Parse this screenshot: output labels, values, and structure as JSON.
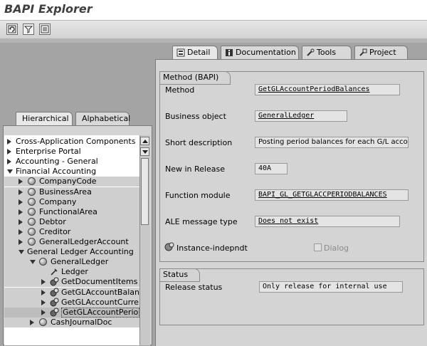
{
  "window": {
    "title": "BAPI Explorer"
  },
  "toolbar": {
    "icons": [
      "refresh-icon",
      "filter-icon",
      "list-icon"
    ]
  },
  "left_tabs": [
    "Hierarchical",
    "Alphabetical"
  ],
  "right_tabs": [
    "Detail",
    "Documentation",
    "Tools",
    "Project"
  ],
  "tree": {
    "items": [
      {
        "label": "Cross-Application Components",
        "level": 0,
        "expanded": false,
        "icon": "triangle"
      },
      {
        "label": "Enterprise Portal",
        "level": 0,
        "expanded": false,
        "icon": "triangle"
      },
      {
        "label": "Accounting - General",
        "level": 0,
        "expanded": false,
        "icon": "triangle"
      },
      {
        "label": "Financial Accounting",
        "level": 0,
        "expanded": true,
        "icon": "triangle"
      },
      {
        "label": "CompanyCode",
        "level": 1,
        "expanded": false,
        "icon": "object"
      },
      {
        "label": "BusinessArea",
        "level": 1,
        "expanded": false,
        "icon": "object"
      },
      {
        "label": "Company",
        "level": 1,
        "expanded": false,
        "icon": "object"
      },
      {
        "label": "FunctionalArea",
        "level": 1,
        "expanded": false,
        "icon": "object"
      },
      {
        "label": "Debtor",
        "level": 1,
        "expanded": false,
        "icon": "object"
      },
      {
        "label": "Creditor",
        "level": 1,
        "expanded": false,
        "icon": "object"
      },
      {
        "label": "GeneralLedgerAccount",
        "level": 1,
        "expanded": false,
        "icon": "object"
      },
      {
        "label": "General Ledger Accounting",
        "level": 1,
        "expanded": true,
        "icon": "triangle"
      },
      {
        "label": "GeneralLedger",
        "level": 2,
        "expanded": true,
        "icon": "object"
      },
      {
        "label": "Ledger",
        "level": 3,
        "expanded": false,
        "icon": "key"
      },
      {
        "label": "GetDocumentItems",
        "level": 3,
        "expanded": false,
        "icon": "method"
      },
      {
        "label": "GetGLAccountBalan",
        "level": 3,
        "expanded": false,
        "icon": "method"
      },
      {
        "label": "GetGLAccountCurre",
        "level": 3,
        "expanded": false,
        "icon": "method"
      },
      {
        "label": "GetGLAccountPerio",
        "level": 3,
        "expanded": false,
        "icon": "method",
        "selected": true
      },
      {
        "label": "CashJournalDoc",
        "level": 2,
        "expanded": false,
        "icon": "object"
      }
    ]
  },
  "method_group": {
    "title": "Method (BAPI)",
    "fields": [
      {
        "label": "Method",
        "value": "GetGLAccountPeriodBalances",
        "underline": true
      },
      {
        "label": "Business object",
        "value": "GeneralLedger",
        "underline": true
      },
      {
        "label": "Short description",
        "value": "Posting period balances for each G/L acco...",
        "underline": false
      },
      {
        "label": "New in Release",
        "value": "40A",
        "underline": false
      },
      {
        "label": "Function module",
        "value": "BAPI_GL_GETGLACCPERIODBALANCES",
        "underline": true
      },
      {
        "label": "ALE message type",
        "value": "Does not exist",
        "underline": true
      }
    ],
    "instance_label": "Instance-indepndt",
    "dialog_label": "Dialog"
  },
  "status_group": {
    "title": "Status",
    "release_label": "Release status",
    "release_value": "Only release for internal use"
  }
}
